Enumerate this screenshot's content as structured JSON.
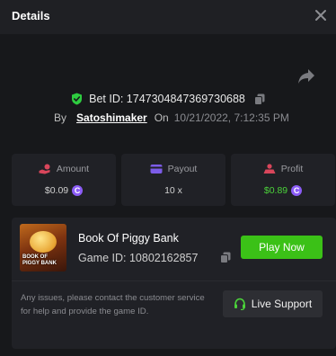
{
  "header": {
    "title": "Details"
  },
  "bet": {
    "id_label": "Bet ID: 1747304847369730688",
    "by_label": "By",
    "user": "Satoshimaker",
    "on_label": "On",
    "date": "10/21/2022, 7:12:35 PM"
  },
  "stats": {
    "amount": {
      "label": "Amount",
      "value": "$0.09",
      "coin": "C"
    },
    "payout": {
      "label": "Payout",
      "value": "10 x"
    },
    "profit": {
      "label": "Profit",
      "value": "$0.89",
      "coin": "C"
    }
  },
  "game": {
    "name": "Book Of Piggy Bank",
    "id_label": "Game ID: 10802162857",
    "thumb_text": "BOOK OF PIGGY BANK",
    "play_label": "Play Now",
    "notice": "Any issues, please contact the customer service for help and provide the game ID.",
    "support_label": "Live Support"
  },
  "colors": {
    "accent_green": "#3bc117",
    "profit_green": "#4bd33a",
    "coin_purple": "#8b5cf6",
    "amount_icon": "#d9465b",
    "payout_icon": "#7c5ce8",
    "profit_icon": "#d9465b",
    "shield_green": "#2ecc40"
  },
  "icons": {
    "close": "close-icon",
    "share": "share-icon",
    "shield": "shield-check-icon",
    "copy": "copy-icon",
    "amount": "hand-coin-icon",
    "payout": "card-icon",
    "profit": "profit-icon",
    "support": "headset-icon"
  }
}
